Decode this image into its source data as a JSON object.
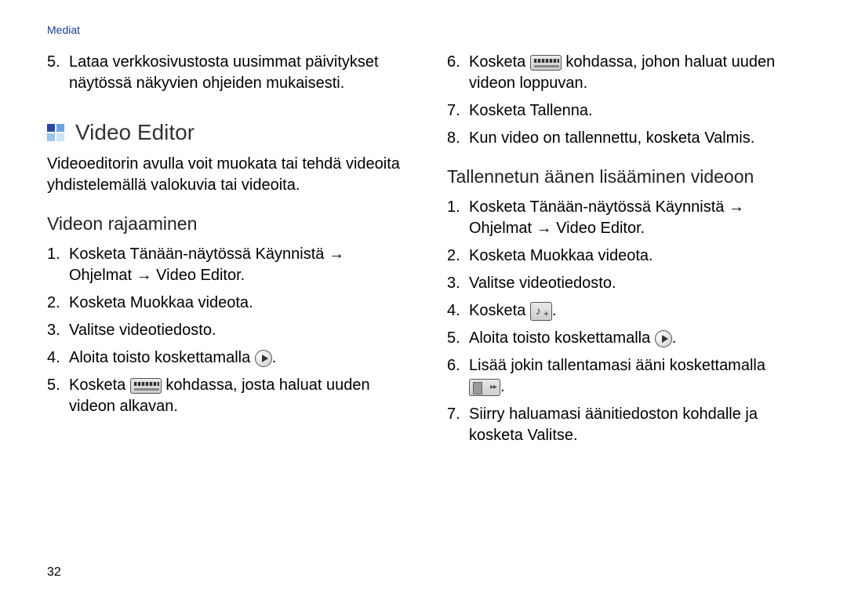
{
  "header": "Mediat",
  "page_number": "32",
  "left": {
    "pre_item": {
      "n": "5.",
      "text": "Lataa verkkosivustosta uusimmat päivitykset näytössä näkyvien ohjeiden mukaisesti."
    },
    "section_title": "Video Editor",
    "section_intro": "Videoeditorin avulla voit muokata tai tehdä videoita yhdistelemällä valokuvia tai videoita.",
    "sub1_title": "Videon rajaaminen",
    "sub1_items": {
      "i1": {
        "n": "1.",
        "a": "Kosketa Tänään-näytössä ",
        "b": "Käynnistä",
        "c": " → ",
        "d": "Ohjelmat",
        "e": " → ",
        "f": "Video Editor",
        "g": "."
      },
      "i2": {
        "n": "2.",
        "a": "Kosketa ",
        "b": "Muokkaa videota",
        "c": "."
      },
      "i3": {
        "n": "3.",
        "a": "Valitse videotiedosto."
      },
      "i4": {
        "n": "4.",
        "a": "Aloita toisto koskettamalla ",
        "b": "."
      },
      "i5": {
        "n": "5.",
        "a": "Kosketa ",
        "b": " kohdassa, josta haluat uuden videon alkavan."
      }
    }
  },
  "right": {
    "top_items": {
      "i6": {
        "n": "6.",
        "a": "Kosketa ",
        "b": " kohdassa, johon haluat uuden videon loppuvan."
      },
      "i7": {
        "n": "7.",
        "a": "Kosketa ",
        "b": "Tallenna",
        "c": "."
      },
      "i8": {
        "n": "8.",
        "a": "Kun video on tallennettu, kosketa ",
        "b": "Valmis",
        "c": "."
      }
    },
    "sub2_title": "Tallennetun äänen lisääminen videoon",
    "sub2_items": {
      "i1": {
        "n": "1.",
        "a": "Kosketa Tänään-näytössä ",
        "b": "Käynnistä",
        "c": " → ",
        "d": "Ohjelmat",
        "e": " → ",
        "f": "Video Editor",
        "g": "."
      },
      "i2": {
        "n": "2.",
        "a": "Kosketa ",
        "b": "Muokkaa videota",
        "c": "."
      },
      "i3": {
        "n": "3.",
        "a": "Valitse videotiedosto."
      },
      "i4": {
        "n": "4.",
        "a": "Kosketa ",
        "b": "."
      },
      "i5": {
        "n": "5.",
        "a": "Aloita toisto koskettamalla ",
        "b": "."
      },
      "i6": {
        "n": "6.",
        "a": "Lisää jokin tallentamasi ääni koskettamalla ",
        "b": "."
      },
      "i7": {
        "n": "7.",
        "a": "Siirry haluamasi äänitiedoston kohdalle ja kosketa ",
        "b": "Valitse",
        "c": "."
      }
    }
  }
}
